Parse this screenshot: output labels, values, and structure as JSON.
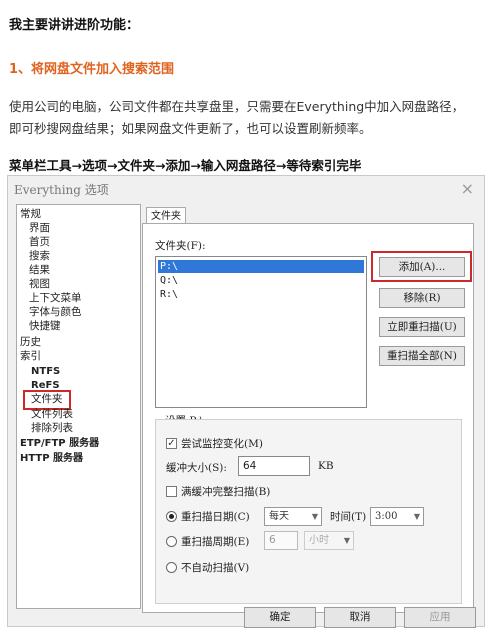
{
  "doc": {
    "heading": "我主要讲讲进阶功能：",
    "section_title": "1、将网盘文件加入搜索范围",
    "para_line1": "使用公司的电脑，公司文件都在共享盘里，只需要在Everything中加入网盘路径，",
    "para_line2": "即可秒搜网盘结果；如果网盘文件更新了，也可以设置刷新频率。",
    "steps": "菜单栏工具→选项→文件夹→添加→输入网盘路径→等待索引完毕"
  },
  "dialog": {
    "title": "Everything 选项",
    "close": "×",
    "tree": [
      "常规",
      "界面",
      "首页",
      "搜索",
      "结果",
      "视图",
      "上下文菜单",
      "字体与颜色",
      "快捷键",
      "历史",
      "索引",
      "NTFS",
      "ReFS",
      "文件夹",
      "文件列表",
      "排除列表",
      "ETP/FTP 服务器",
      "HTTP 服务器"
    ],
    "tab_label": "文件夹",
    "folders_label": "文件夹(F):",
    "folders": [
      "P:\\",
      "Q:\\",
      "R:\\"
    ],
    "buttons": {
      "add": "添加(A)...",
      "remove": "移除(R)",
      "rescan_now": "立即重扫描(U)",
      "rescan_all": "重扫描全部(N)"
    },
    "settings": {
      "title": "设置 P:\\",
      "try_monitor": "尝试监控变化(M)",
      "try_monitor_checked": true,
      "buffer_label": "缓冲大小(S):",
      "buffer_value": "64",
      "buffer_unit": "KB",
      "full_rescan": "满缓冲完整扫描(B)",
      "full_rescan_checked": false,
      "rescan_daily": "重扫描日期(C)",
      "daily_value": "每天",
      "time_label": "时间(T)",
      "time_value": "3:00",
      "rescan_period": "重扫描周期(E)",
      "period_value": "6",
      "period_unit": "小时",
      "no_auto": "不自动扫描(V)",
      "selected_radio": "daily"
    },
    "footer": {
      "ok": "确定",
      "cancel": "取消",
      "apply": "应用"
    }
  }
}
